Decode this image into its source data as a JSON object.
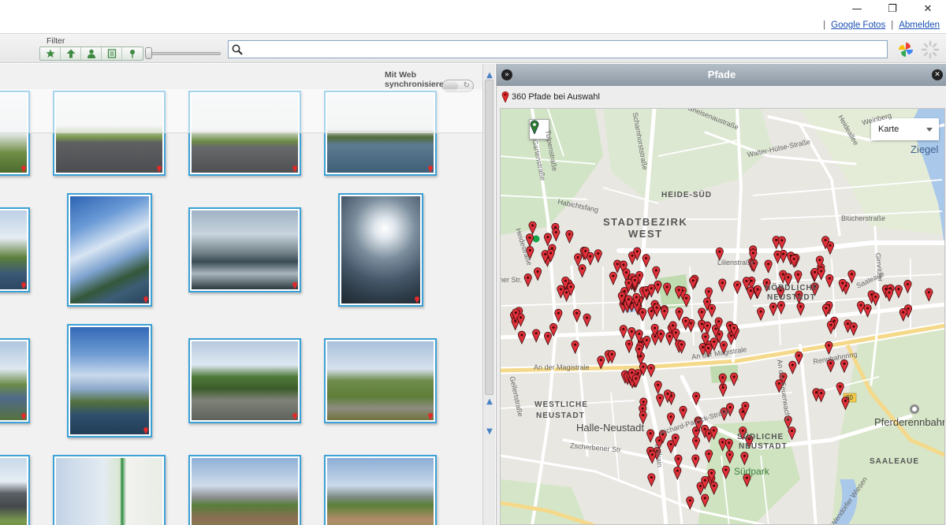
{
  "window": {
    "minimize_icon": "minimize-icon",
    "restore_icon": "restore-icon",
    "close_icon": "close-icon"
  },
  "top_links": {
    "separator": "|",
    "google_fotos": "Google Fotos",
    "abmelden": "Abmelden"
  },
  "toolbar": {
    "filter_label": "Filter",
    "filters": [
      "star-icon",
      "upload-arrow-icon",
      "person-icon",
      "film-icon",
      "map-pin-icon"
    ],
    "search_placeholder": "",
    "search_value": ""
  },
  "gallery": {
    "sync_label": "Mit Web synchronisieren",
    "sync_toggle_on": false
  },
  "pane": {
    "title": "Pfade",
    "path_count": "360 Pfade bei Auswahl"
  },
  "map": {
    "type_select": "Karte",
    "labels": {
      "stadtbezirk": "STADTBEZIRK",
      "west": "WEST",
      "heide_sued": "HEIDE-SÜD",
      "nordliche": "NÖRDLICHE",
      "neustadt_n": "NEUSTADT",
      "westliche": "WESTLICHE",
      "neustadt_w": "NEUSTADT",
      "suedliche": "SÜDLICHE",
      "neustadt_s": "NEUSTADT",
      "halle_neustadt": "Halle-Neustadt",
      "suedpark": "Südpark",
      "saaleaue": "SAALEAUE",
      "pferderennbahn": "Pferderennbahn",
      "ziegel": "Ziegel",
      "gneisenaustrasse": "Gneisenaustraße",
      "walter_huelse": "Walter-Hülse-Straße",
      "bluecherstrasse": "Blücherstraße",
      "heideallee": "Heideallee",
      "weinberg": "Weinberg",
      "habichtsfang": "Habichtsfang",
      "tulpenstrasse": "Tulpenstraße",
      "gartenstrasse": "Gartenstraße",
      "schomburgstrasse": "Scharnhorststraße",
      "lilienstrasse": "Lilienstraße",
      "heidestrasse": "Heidestraße",
      "saaleaue_str": "Saaleaue",
      "gimritzer": "Gimritzer",
      "an_der_magistrale_w": "An der Magistrale",
      "an_der_magistrale_e": "An der Magistrale",
      "rennbahnring": "Rennbahnring",
      "an_der_feuerwache": "An der Feuerwache",
      "gellertstrasse": "Gellertstraße",
      "zscherbener": "Zscherbener Str.",
      "paulick": "Richard-Paulick-Straße",
      "zollrain": "Zollrain",
      "kirchner_wiesen": "Am Wendorfer Wiesen",
      "route_80": "80",
      "str_w": "ner Str."
    }
  }
}
